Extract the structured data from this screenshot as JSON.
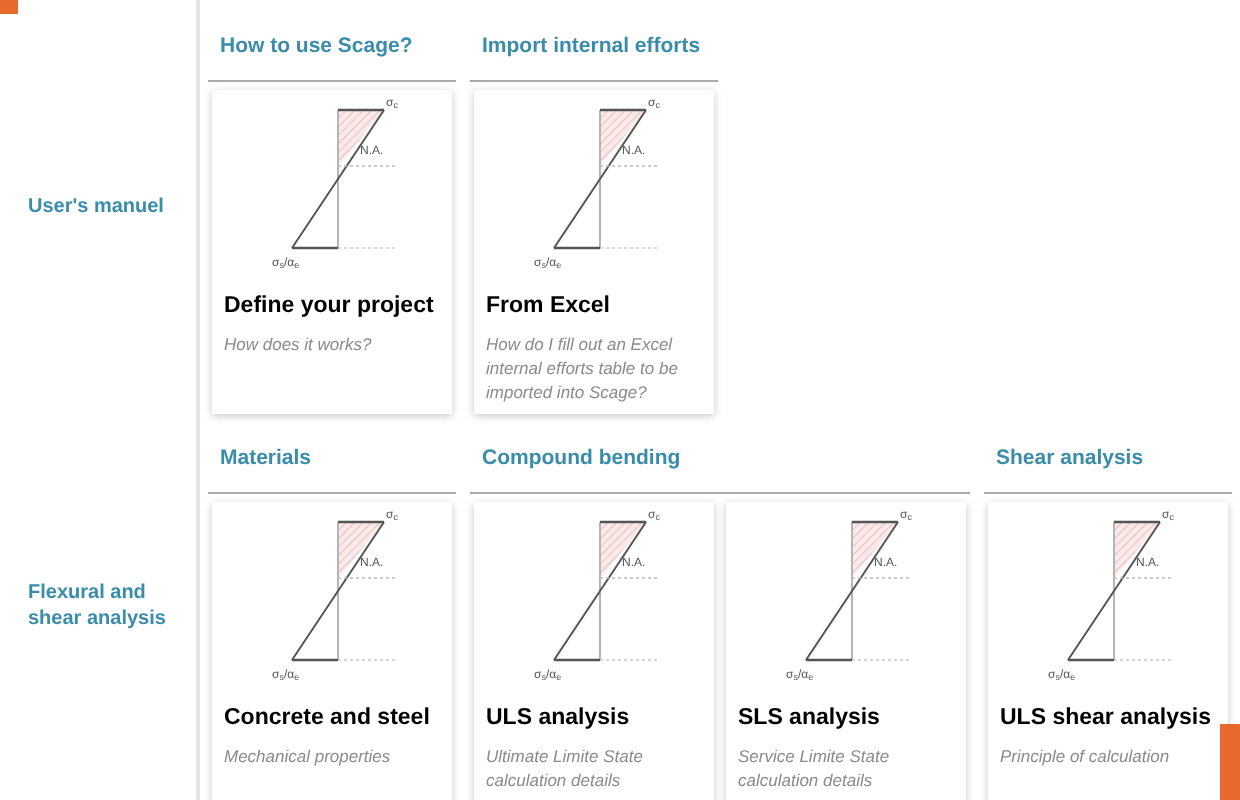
{
  "sections": [
    {
      "title": "User's manuel",
      "groups": [
        {
          "title": "How to use Scage?",
          "cards": [
            {
              "title": "Define your project",
              "description": "How does it works?",
              "diagram": {
                "top_label": "σ$_{c}$",
                "axis_label": "N.A.",
                "bottom_label": "σ$_{s}$/α$_{e}$"
              }
            }
          ]
        },
        {
          "title": "Import internal efforts",
          "cards": [
            {
              "title": "From Excel",
              "description": "How do I fill out an Excel internal efforts table to be imported into Scage?",
              "diagram": {
                "top_label": "σ$_{c}$",
                "axis_label": "N.A.",
                "bottom_label": "σ$_{s}$/α$_{e}$"
              }
            }
          ]
        }
      ]
    },
    {
      "title": "Flexural and shear analysis",
      "groups": [
        {
          "title": "Materials",
          "cards": [
            {
              "title": "Concrete and steel",
              "description": "Mechanical properties",
              "diagram": {
                "top_label": "σ$_{c}$",
                "axis_label": "N.A.",
                "bottom_label": "σ$_{s}$/α$_{e}$"
              }
            }
          ]
        },
        {
          "title": "Compound bending",
          "cards": [
            {
              "title": "ULS analysis",
              "description": "Ultimate Limite State calculation details",
              "diagram": {
                "top_label": "σ$_{c}$",
                "axis_label": "N.A.",
                "bottom_label": "σ$_{s}$/α$_{e}$"
              }
            },
            {
              "title": "SLS analysis",
              "description": "Service Limite State calculation details",
              "diagram": {
                "top_label": "σ$_{c}$",
                "axis_label": "N.A.",
                "bottom_label": "σ$_{s}$/α$_{e}$"
              }
            }
          ]
        },
        {
          "title": "Shear analysis",
          "cards": [
            {
              "title": "ULS shear analysis",
              "description": "Principle of calculation",
              "diagram": {
                "top_label": "σ$_{c}$",
                "axis_label": "N.A.",
                "bottom_label": "σ$_{s}$/α$_{e}$"
              }
            }
          ]
        }
      ]
    }
  ]
}
